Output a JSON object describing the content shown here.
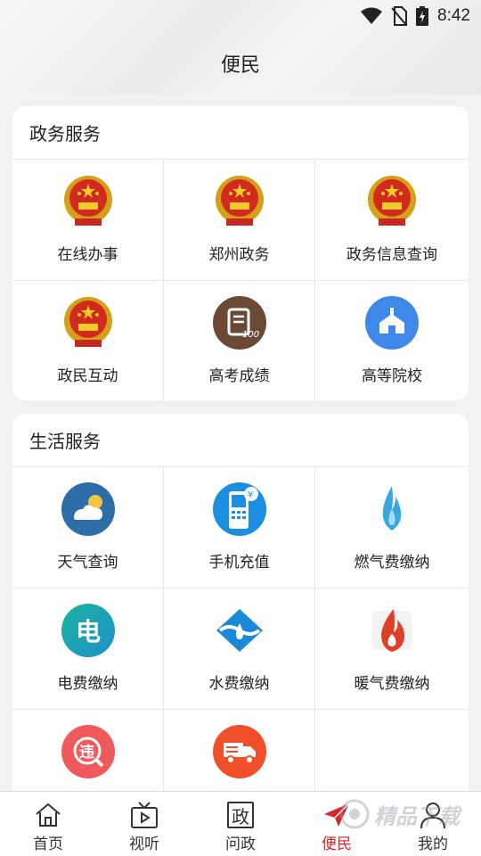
{
  "status_bar": {
    "time": "8:42",
    "icons": [
      "wifi-icon",
      "no-sim-icon",
      "battery-charging-icon"
    ]
  },
  "page": {
    "title": "便民"
  },
  "gov_section": {
    "title": "政务服务",
    "items": [
      {
        "label": "在线办事",
        "icon": "national-emblem-icon"
      },
      {
        "label": "郑州政务",
        "icon": "national-emblem-icon"
      },
      {
        "label": "政务信息查询",
        "icon": "national-emblem-icon"
      },
      {
        "label": "政民互动",
        "icon": "national-emblem-icon"
      },
      {
        "label": "高考成绩",
        "icon": "exam-score-icon",
        "color": "#6b4a35"
      },
      {
        "label": "高等院校",
        "icon": "university-icon",
        "color": "#3d88e8"
      }
    ]
  },
  "life_section": {
    "title": "生活服务",
    "items": [
      {
        "label": "天气查询",
        "icon": "weather-icon",
        "color": "#2d6ea8"
      },
      {
        "label": "手机充值",
        "icon": "phone-topup-icon",
        "color": "#1a8ee0"
      },
      {
        "label": "燃气费缴纳",
        "icon": "gas-flame-icon",
        "color": "#3aa7e0"
      },
      {
        "label": "电费缴纳",
        "icon": "electricity-icon",
        "color": "#1fb48a"
      },
      {
        "label": "水费缴纳",
        "icon": "water-icon",
        "color": "#1a8ad8"
      },
      {
        "label": "暖气费缴纳",
        "icon": "heating-flame-icon",
        "color": "#e0402a"
      },
      {
        "label": "",
        "icon": "traffic-violation-icon",
        "color": "#f05a5a"
      },
      {
        "label": "",
        "icon": "truck-icon",
        "color": "#f04f2a"
      }
    ]
  },
  "bottom_nav": {
    "items": [
      {
        "label": "首页",
        "icon": "home-icon"
      },
      {
        "label": "视听",
        "icon": "tv-play-icon"
      },
      {
        "label": "问政",
        "icon": "zheng-character-icon",
        "glyph": "政"
      },
      {
        "label": "便民",
        "icon": "paper-plane-icon",
        "active": true
      },
      {
        "label": "我的",
        "icon": "user-icon"
      }
    ],
    "accent": "#d8262b"
  },
  "watermark": {
    "text": "精品下载"
  }
}
